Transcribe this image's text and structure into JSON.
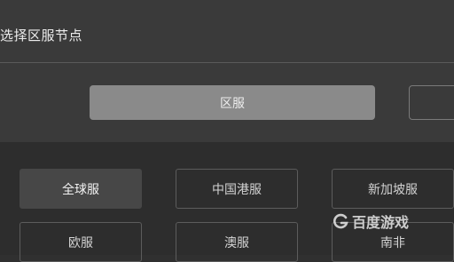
{
  "header": {
    "title": "选择区服节点"
  },
  "tabs": [
    {
      "label": "区服",
      "active": true
    },
    {
      "label": "",
      "active": false
    }
  ],
  "nodes": [
    {
      "label": "全球服",
      "selected": true
    },
    {
      "label": "中国港服",
      "selected": false
    },
    {
      "label": "新加坡服",
      "selected": false
    },
    {
      "label": "欧服",
      "selected": false
    },
    {
      "label": "澳服",
      "selected": false
    },
    {
      "label": "南非",
      "selected": false
    }
  ],
  "watermark": {
    "text": "百度游戏",
    "icon": "baidu-game-logo-icon"
  }
}
